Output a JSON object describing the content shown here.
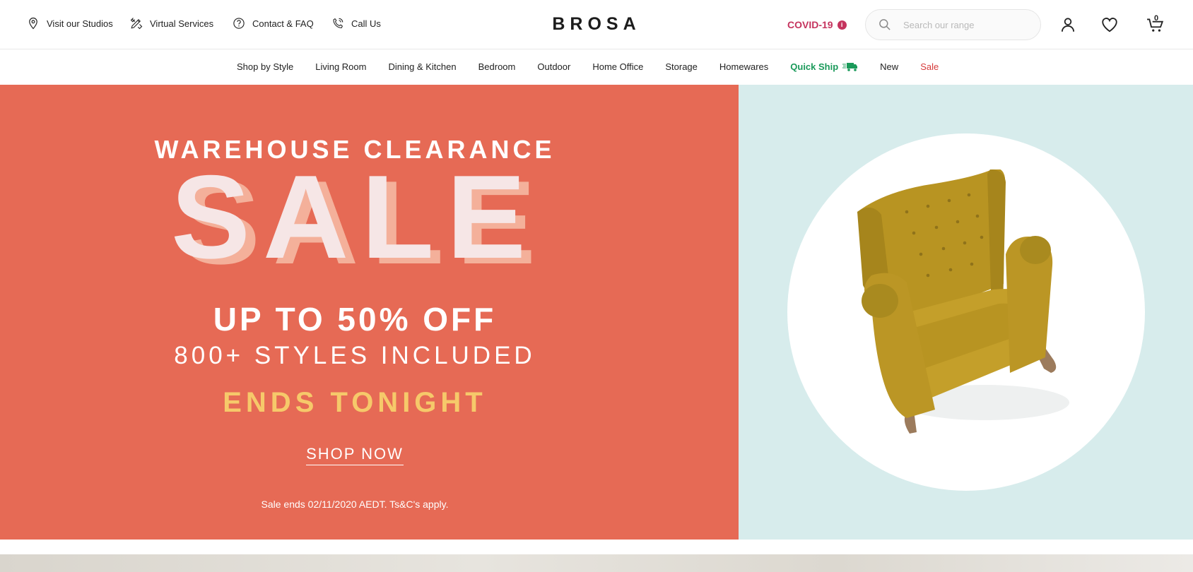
{
  "utility": {
    "visit": "Visit our Studios",
    "virtual": "Virtual Services",
    "contact": "Contact & FAQ",
    "call": "Call Us"
  },
  "brand": {
    "logo": "BROSA"
  },
  "covid": {
    "label": "COVID-19",
    "info": "i"
  },
  "search": {
    "placeholder": "Search our range"
  },
  "cart": {
    "count": "0"
  },
  "nav": {
    "items": [
      {
        "label": "Shop by Style"
      },
      {
        "label": "Living Room"
      },
      {
        "label": "Dining & Kitchen"
      },
      {
        "label": "Bedroom"
      },
      {
        "label": "Outdoor"
      },
      {
        "label": "Home Office"
      },
      {
        "label": "Storage"
      },
      {
        "label": "Homewares"
      },
      {
        "label": "Quick Ship"
      },
      {
        "label": "New"
      },
      {
        "label": "Sale"
      }
    ]
  },
  "hero": {
    "title": "WAREHOUSE CLEARANCE",
    "sale": "SALE",
    "offer": "UP TO 50% OFF",
    "styles": "800+ STYLES INCLUDED",
    "ends": "ENDS TONIGHT",
    "cta": "SHOP NOW",
    "terms": "Sale ends 02/11/2020 AEDT. Ts&C's apply."
  },
  "colors": {
    "hero_bg": "#e66a55",
    "hero_right_bg": "#d7ecec",
    "accent_yellow": "#f6c96a",
    "covid": "#c5345e",
    "quick_ship": "#1a9a5a",
    "sale_nav": "#d63b3b"
  },
  "icons": {
    "visit": "location-pin-icon",
    "virtual": "pencil-ruler-icon",
    "contact": "question-circle-icon",
    "call": "phone-icon",
    "search": "search-icon",
    "account": "user-icon",
    "wishlist": "heart-icon",
    "cart": "cart-icon",
    "quick_ship": "truck-icon"
  }
}
